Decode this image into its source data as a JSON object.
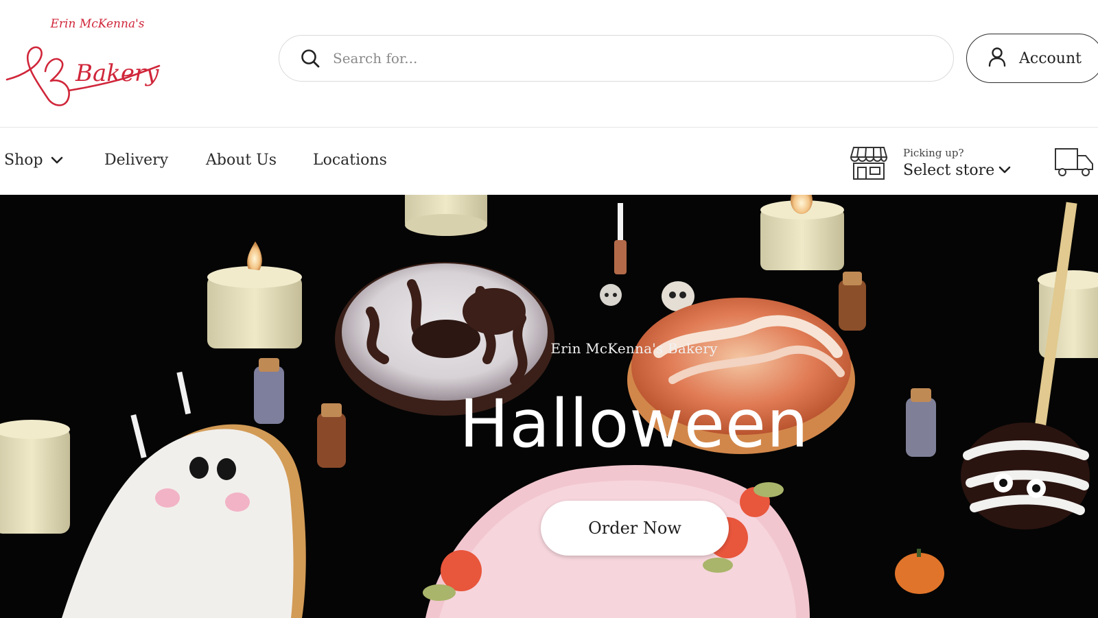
{
  "brand": {
    "logo_top_text": "Erin McKenna's",
    "logo_main_text": "Bakery",
    "logo_color": "#d0263a"
  },
  "search": {
    "placeholder": "Search for..."
  },
  "account": {
    "label": "Account"
  },
  "nav": {
    "items": [
      {
        "label": "Shop",
        "has_dropdown": true
      },
      {
        "label": "Delivery"
      },
      {
        "label": "About Us"
      },
      {
        "label": "Locations"
      }
    ],
    "store": {
      "prompt": "Picking up?",
      "action": "Select store"
    }
  },
  "hero": {
    "eyebrow": "Erin McKenna's Bakery",
    "title": "Halloween",
    "cta": "Order Now"
  },
  "colors": {
    "hero_bg": "#050505",
    "text_dark": "#222222",
    "border": "#d9d9d9"
  }
}
